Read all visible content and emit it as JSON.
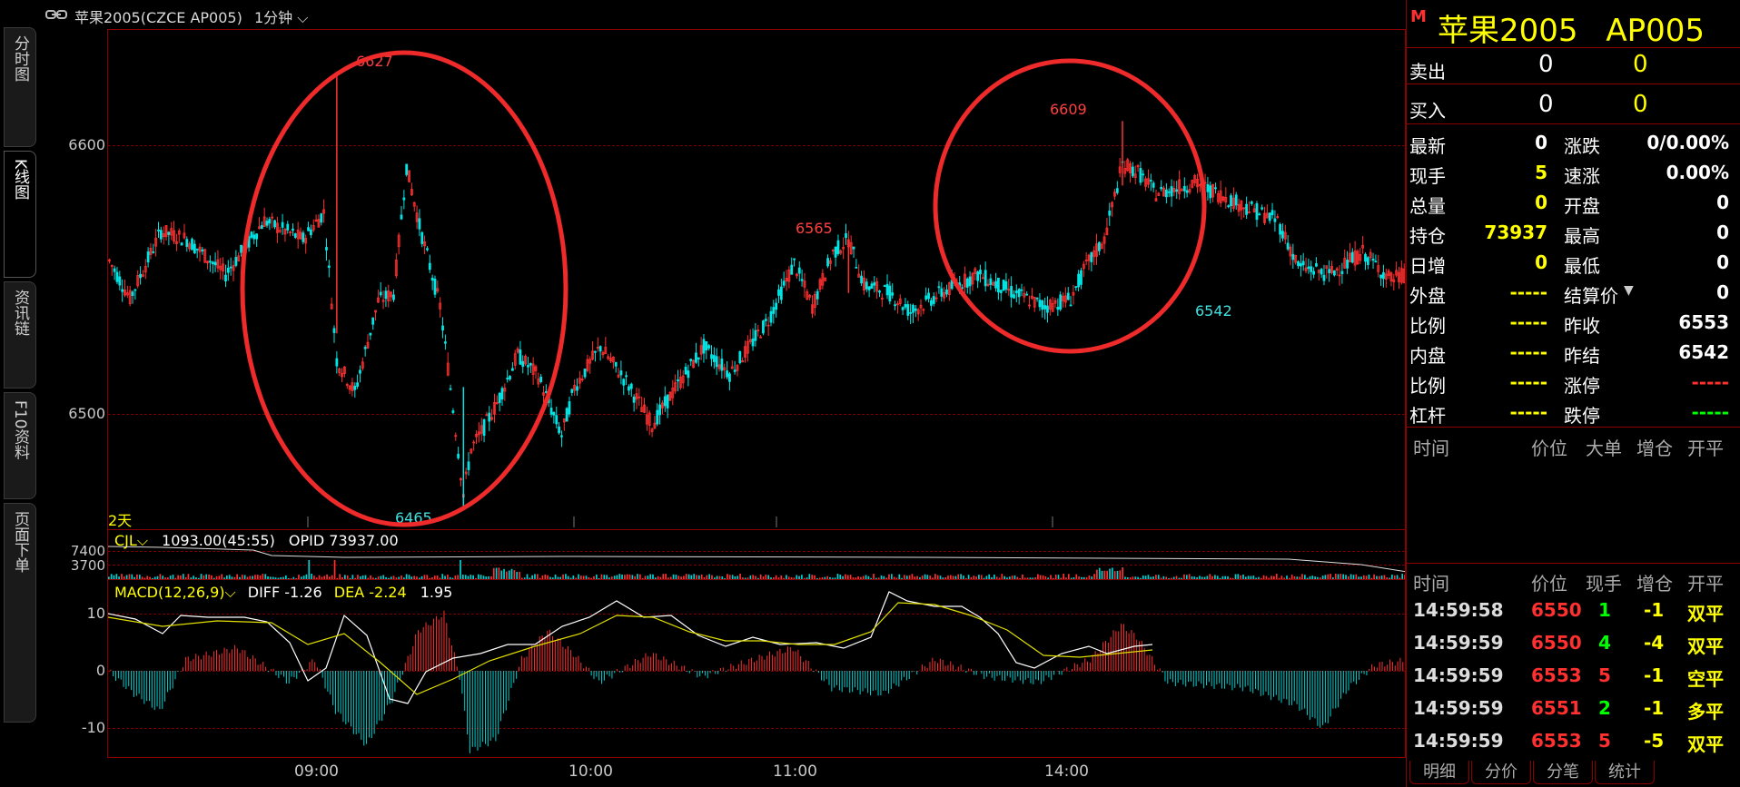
{
  "topbar": {
    "link_icon": "link-icon",
    "title": "苹果2005(CZCE AP005)",
    "period": "1分钟",
    "period_arrow": "⌵"
  },
  "left_tabs": [
    {
      "label": "分时图"
    },
    {
      "label": "K线图"
    },
    {
      "label": "资讯链"
    },
    {
      "label": "F10资料"
    },
    {
      "label": "页面下单"
    }
  ],
  "kline": {
    "y_ticks": [
      "6600",
      "6500"
    ],
    "range_label": "2天",
    "annotations": [
      {
        "text": "6627",
        "color": "#ff4040"
      },
      {
        "text": "6465",
        "color": "#40e0e0"
      },
      {
        "text": "6565",
        "color": "#ff4040"
      },
      {
        "text": "6609",
        "color": "#ff4040"
      },
      {
        "text": "6542",
        "color": "#40e0e0"
      }
    ]
  },
  "volume": {
    "indicator": "CJL",
    "value": "1093.00(45:55)",
    "opid": "OPID 73937.00",
    "y_ticks": [
      "7400",
      "3700"
    ]
  },
  "macd": {
    "indicator": "MACD(12,26,9)",
    "diff": "DIFF -1.26",
    "dea": "DEA -2.24",
    "macd_value": "1.95",
    "y_ticks": [
      "10",
      "0",
      "-10"
    ]
  },
  "x_axis": [
    "09:00",
    "10:00",
    "11:00",
    "14:00"
  ],
  "panel": {
    "m_badge": "M",
    "title": "苹果2005",
    "code": "AP005",
    "sell": {
      "label": "卖出",
      "price": "0",
      "vol": "0"
    },
    "buy": {
      "label": "买入",
      "price": "0",
      "vol": "0"
    },
    "quote_left": [
      {
        "label": "最新",
        "value": "0",
        "color": "#ffffff"
      },
      {
        "label": "现手",
        "value": "5",
        "color": "#ffff00"
      },
      {
        "label": "总量",
        "value": "0",
        "color": "#ffff00"
      },
      {
        "label": "持仓",
        "value": "73937",
        "color": "#ffff00"
      },
      {
        "label": "日增",
        "value": "0",
        "color": "#ffff00"
      },
      {
        "label": "外盘",
        "value": "-----",
        "color": "#ffff00"
      },
      {
        "label": "比例",
        "value": "-----",
        "color": "#ffff00"
      },
      {
        "label": "内盘",
        "value": "-----",
        "color": "#ffff00"
      },
      {
        "label": "比例",
        "value": "-----",
        "color": "#ffff00"
      },
      {
        "label": "杠杆",
        "value": "-----",
        "color": "#ffff00"
      }
    ],
    "quote_right": [
      {
        "label": "涨跌",
        "value": "0/0.00%",
        "color": "#ffffff"
      },
      {
        "label": "速涨",
        "value": "0.00%",
        "color": "#ffffff"
      },
      {
        "label": "开盘",
        "value": "0",
        "color": "#ffffff"
      },
      {
        "label": "最高",
        "value": "0",
        "color": "#ffffff"
      },
      {
        "label": "最低",
        "value": "0",
        "color": "#ffffff"
      },
      {
        "label": "结算价",
        "value": "0",
        "color": "#ffffff"
      },
      {
        "label": "昨收",
        "value": "6553",
        "color": "#ffffff"
      },
      {
        "label": "昨结",
        "value": "6542",
        "color": "#ffffff"
      },
      {
        "label": "涨停",
        "value": "-----",
        "color": "#ff3030"
      },
      {
        "label": "跌停",
        "value": "-----",
        "color": "#00ff00"
      }
    ],
    "big_order_header": [
      "时间",
      "价位",
      "大单",
      "增仓",
      "开平"
    ],
    "ticks_header": [
      "时间",
      "价位",
      "现手",
      "增仓",
      "开平"
    ],
    "ticks": [
      {
        "time": "14:59:58",
        "price": "6550",
        "vol": "1",
        "oi": "-1",
        "type": "双平",
        "vol_color": "#00ff00"
      },
      {
        "time": "14:59:59",
        "price": "6550",
        "vol": "4",
        "oi": "-4",
        "type": "双平",
        "vol_color": "#00ff00"
      },
      {
        "time": "14:59:59",
        "price": "6553",
        "vol": "5",
        "oi": "-1",
        "type": "空平",
        "vol_color": "#ff3030"
      },
      {
        "time": "14:59:59",
        "price": "6551",
        "vol": "2",
        "oi": "-1",
        "type": "多平",
        "vol_color": "#00ff00"
      },
      {
        "time": "14:59:59",
        "price": "6553",
        "vol": "5",
        "oi": "-5",
        "type": "双平",
        "vol_color": "#ff3030"
      }
    ],
    "bottom_tabs": [
      "明细",
      "分价",
      "分笔",
      "统计"
    ]
  }
}
